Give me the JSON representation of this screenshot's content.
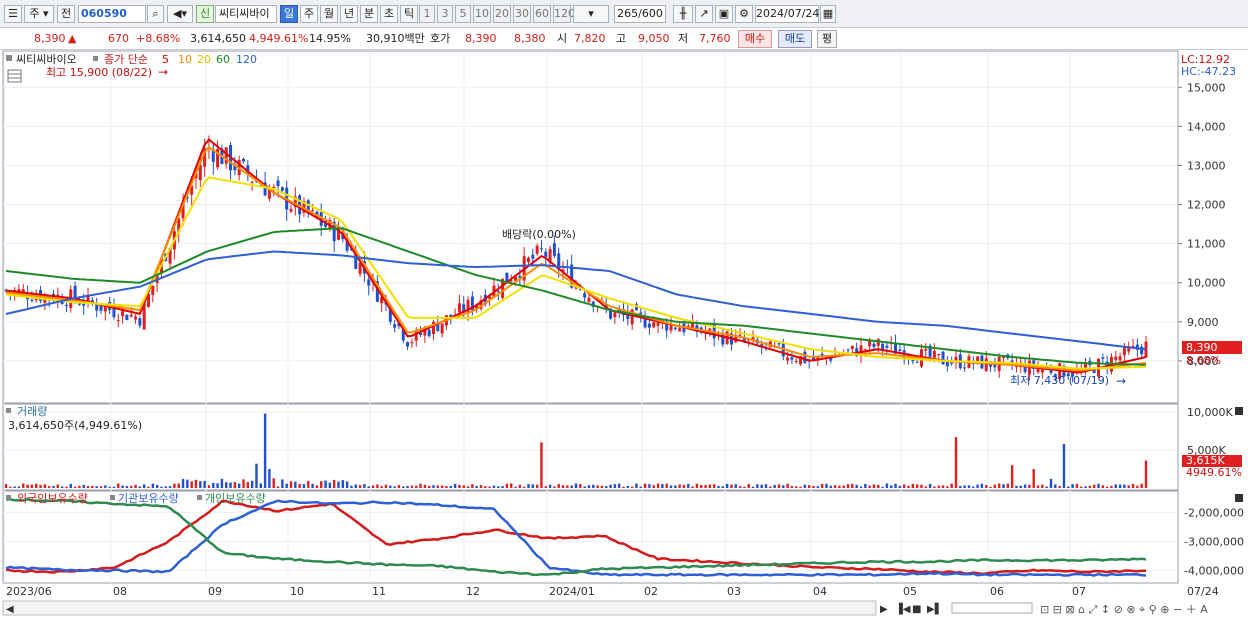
{
  "toolbar": {
    "market": "주",
    "prev_label": "전",
    "stock_code": "060590",
    "stock_type_badge": "신",
    "stock_name": "씨티씨바이",
    "periods": [
      "일",
      "주",
      "월",
      "년",
      "분",
      "초",
      "틱"
    ],
    "active_period": "일",
    "intervals": [
      "1",
      "3",
      "5",
      "10",
      "20",
      "30",
      "60",
      "120"
    ],
    "count": "265",
    "count_max": "/600",
    "date": "2024/07/24"
  },
  "info_bar": {
    "price": "8,390",
    "arrow": "▲",
    "change": "670",
    "change_pct": "+8.68%",
    "volume": "3,614,650",
    "volume_ratio": "4,949.61%",
    "turnover": "14.95%",
    "amount": "30,910백만",
    "quote_label": "호가",
    "ask": "8,390",
    "bid": "8,380",
    "open_label": "시",
    "open": "7,820",
    "high_label": "고",
    "high": "9,050",
    "low_label": "저",
    "low": "7,760",
    "buy_label": "매수",
    "sell_label": "매도",
    "avg_label": "평"
  },
  "price_panel": {
    "legend_title": "씨티씨바이오",
    "legend_ma_label": "종가 단순",
    "legend_ma_periods": [
      "5",
      "10",
      "20",
      "60",
      "120"
    ],
    "high_marker": "최고 15,900 (08/22)",
    "low_marker": "최저 7,430 (07/19)",
    "dividend_marker": "배당락(0.00%)",
    "lc": "LC:12.92",
    "hc": "HC:-47.23",
    "current_price": "8,390",
    "current_pct": "8.68%"
  },
  "volume_panel": {
    "title": "거래량",
    "info": "3,614,650주(4,949.61%)",
    "current": "3,615K",
    "current_pct": "4949.61%"
  },
  "holding_panel": {
    "legend": [
      "외국인보유수량",
      "기관보유수량",
      "개인보유수량"
    ]
  },
  "x_axis_labels": [
    "2023/06",
    "08",
    "09",
    "10",
    "11",
    "12",
    "2024/01",
    "02",
    "03",
    "04",
    "05",
    "06",
    "07",
    "07/24"
  ],
  "colors": {
    "ma5": "#e00000",
    "ma10": "#ff8c00",
    "ma20": "#f2e000",
    "ma60": "#1f8a2a",
    "ma120": "#2f5fd6",
    "up": "#e02020",
    "down": "#2050d0",
    "foreign": "#d41a1a",
    "institution": "#2f5fd6",
    "individual": "#2f8a50"
  },
  "chart_data": [
    {
      "type": "candlestick",
      "title": "씨티씨바이오",
      "ylim": [
        7000,
        15800
      ],
      "y_ticks": [
        8000,
        9000,
        10000,
        11000,
        12000,
        13000,
        14000,
        15000
      ],
      "y_tick_labels": [
        "8,000",
        "9,000",
        "10,000",
        "11,000",
        "12,000",
        "13,000",
        "14,000",
        "15,000"
      ],
      "x": [
        "2023/06",
        "08",
        "09",
        "10",
        "11",
        "12",
        "2024/01",
        "02",
        "03",
        "04",
        "05",
        "06",
        "07"
      ],
      "series": [
        {
          "name": "종가",
          "values": [
            9800,
            9600,
            9100,
            13500,
            12300,
            11200,
            8500,
            9500,
            10800,
            9200,
            8900,
            8500,
            8000,
            8400,
            8000,
            7900,
            7700,
            8390
          ]
        },
        {
          "name": "5",
          "values": [
            9800,
            9600,
            9200,
            13700,
            12300,
            11300,
            8600,
            9400,
            10700,
            9300,
            8900,
            8500,
            8000,
            8300,
            8000,
            7900,
            7700,
            8100
          ]
        },
        {
          "name": "10",
          "values": [
            9750,
            9550,
            9300,
            13500,
            12300,
            11400,
            8700,
            9300,
            10500,
            9400,
            8900,
            8600,
            8100,
            8200,
            8000,
            7900,
            7750,
            7950
          ]
        },
        {
          "name": "20",
          "values": [
            9700,
            9500,
            9400,
            12700,
            12400,
            11600,
            9100,
            9100,
            10200,
            9600,
            9100,
            8700,
            8300,
            8100,
            8000,
            7950,
            7800,
            7850
          ]
        },
        {
          "name": "60",
          "values": [
            10300,
            10100,
            10000,
            10800,
            11300,
            11400,
            10800,
            10200,
            9800,
            9300,
            9000,
            8900,
            8700,
            8500,
            8300,
            8100,
            7950,
            7900
          ]
        },
        {
          "name": "120",
          "values": [
            9200,
            9600,
            9900,
            10600,
            10800,
            10700,
            10500,
            10400,
            10450,
            10300,
            9700,
            9400,
            9200,
            9000,
            8900,
            8700,
            8500,
            8300
          ]
        }
      ]
    },
    {
      "type": "bar",
      "title": "거래량",
      "y_tick_labels": [
        "5,000K",
        "10,000K"
      ],
      "ylim": [
        0,
        10000
      ],
      "note": "daily volume bars; spikes in 08 (~9,800K), 09 (~6,000K), 05 (~6,700K), 07 (~5,800K) and today 3,615K"
    },
    {
      "type": "line",
      "title": "보유수량",
      "y_tick_labels": [
        "-2,000,000",
        "-3,000,000",
        "-4,000,000"
      ],
      "ylim": [
        -4400000,
        -1400000
      ],
      "series": [
        {
          "name": "외국인보유수량"
        },
        {
          "name": "기관보유수량"
        },
        {
          "name": "개인보유수량"
        }
      ]
    }
  ]
}
